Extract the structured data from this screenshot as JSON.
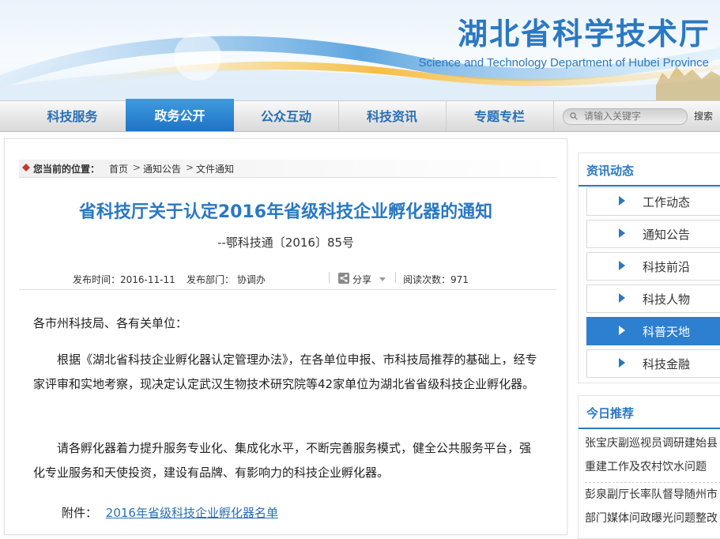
{
  "header": {
    "title": "湖北省科学技术厅",
    "subtitle": "Science and Technology Department of Hubei Province"
  },
  "nav": {
    "items": [
      {
        "label": "科技服务",
        "active": false
      },
      {
        "label": "政务公开",
        "active": true
      },
      {
        "label": "公众互动",
        "active": false
      },
      {
        "label": "科技资讯",
        "active": false
      },
      {
        "label": "专题专栏",
        "active": false
      }
    ],
    "search_placeholder": "请输入关键字",
    "search_label": "搜索"
  },
  "breadcrumb": {
    "label": "您当前的位置：",
    "items": [
      "首页",
      "通知公告",
      "文件通知"
    ],
    "separator": ">"
  },
  "article": {
    "title": "省科技厅关于认定2016年省级科技企业孵化器的通知",
    "doc_number": "--鄂科技通〔2016〕85号",
    "publish_time": "发布时间：2016-11-11",
    "department": "发布部门： 协调办",
    "share": "分享",
    "read_count": "阅读次数：971",
    "salutation": "各市州科技局、各有关单位：",
    "paragraphs": [
      "根据《湖北省科技企业孵化器认定管理办法》，在各单位申报、市科技局推荐的基础上，经专家评审和实地考察，现决定认定武汉生物技术研究院等42家单位为湖北省省级科技企业孵化器。",
      "请各孵化器着力提升服务专业化、集成化水平，不断完善服务模式，健全公共服务平台，强化专业服务和天使投资，建设有品牌、有影响力的科技企业孵化器。"
    ],
    "attachment_label": "附件：",
    "attachment_link": "2016年省级科技企业孵化器名单"
  },
  "sidebar": {
    "news_title": "资讯动态",
    "news_items": [
      {
        "label": "工作动态",
        "active": false
      },
      {
        "label": "通知公告",
        "active": false
      },
      {
        "label": "科技前沿",
        "active": false
      },
      {
        "label": "科技人物",
        "active": false
      },
      {
        "label": "科普天地",
        "active": true
      },
      {
        "label": "科技金融",
        "active": false
      }
    ],
    "recommend_title": "今日推荐",
    "recommend_items": [
      {
        "line1": "张宝庆副巡视员调研建始县",
        "line2": "重建工作及农村饮水问题"
      },
      {
        "line1": "彭泉副厅长率队督导随州市",
        "line2": "部门媒体问政曝光问题整改"
      }
    ]
  },
  "colors": {
    "brand_blue": "#2a78c2",
    "active_blue": "#2d7fcf",
    "link_blue": "#2a6fb3"
  }
}
